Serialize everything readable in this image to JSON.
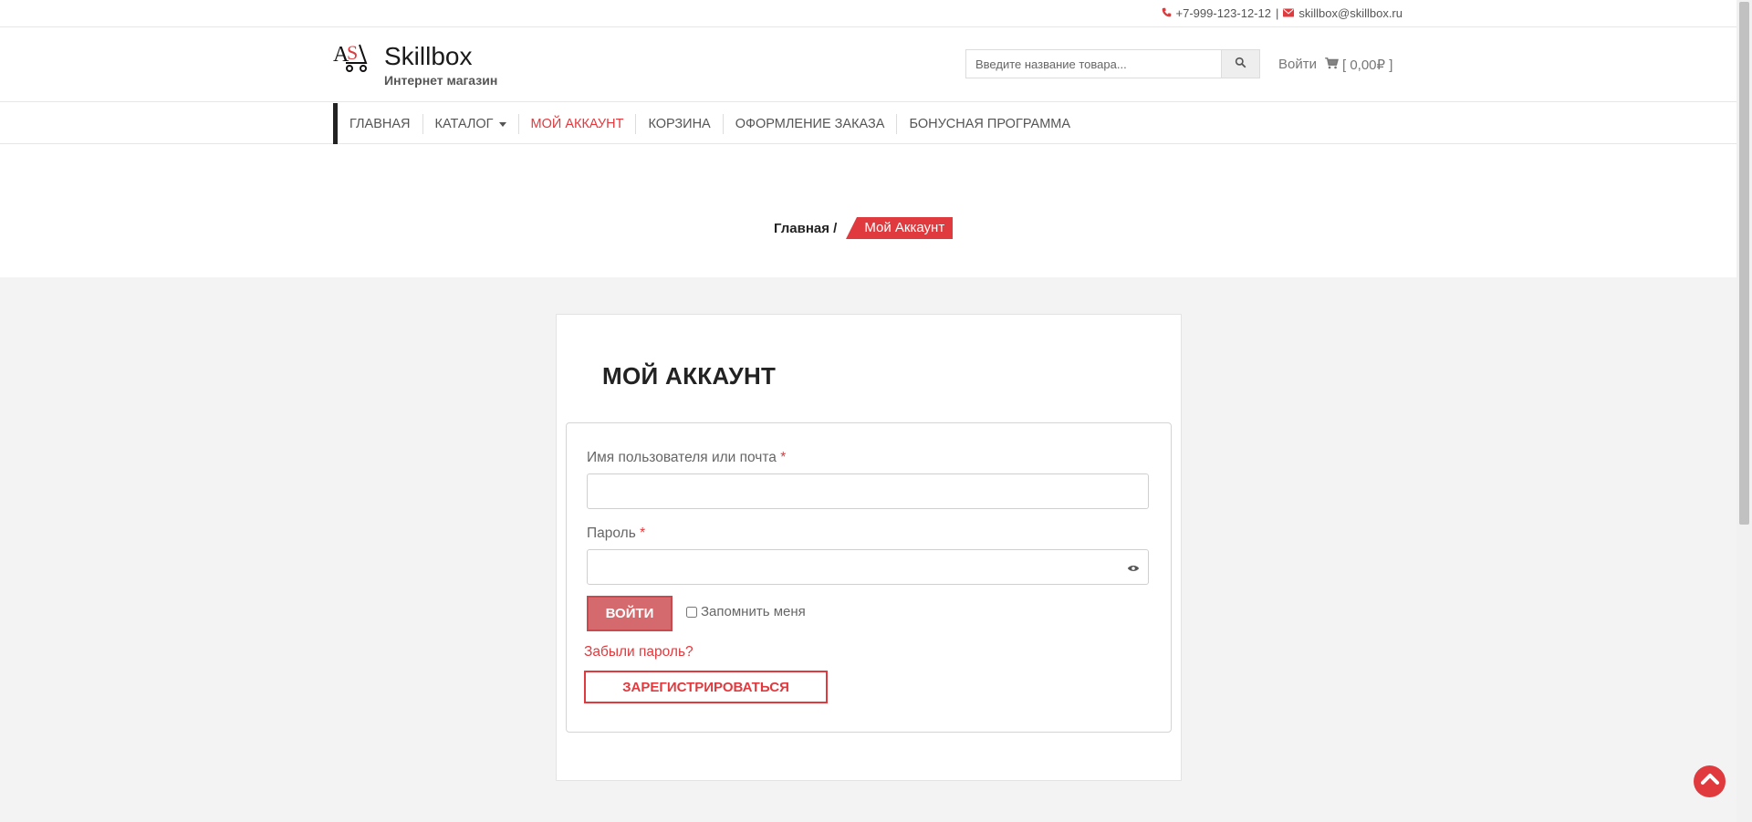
{
  "topbar": {
    "phone": "+7-999-123-12-12",
    "separator": "|",
    "email": "skillbox@skillbox.ru"
  },
  "header": {
    "brand_name": "Skillbox",
    "brand_tagline": "Интернет магазин",
    "search_placeholder": "Введите название товара...",
    "login_label": "Войти",
    "cart_label": "[ 0,00₽ ]"
  },
  "nav": {
    "items": [
      {
        "label": "ГЛАВНАЯ"
      },
      {
        "label": "КАТАЛОГ"
      },
      {
        "label": "МОЙ АККАУНТ"
      },
      {
        "label": "КОРЗИНА"
      },
      {
        "label": "ОФОРМЛЕНИЕ ЗАКАЗА"
      },
      {
        "label": "БОНУСНАЯ ПРОГРАММА"
      }
    ],
    "active": "МОЙ АККАУНТ"
  },
  "breadcrumb": {
    "home": "Главная /",
    "current": "Мой Аккаунт"
  },
  "account": {
    "title": "МОЙ АККАУНТ",
    "username_label": "Имя пользователя или почта",
    "password_label": "Пароль",
    "required_mark": "*",
    "login_button": "ВОЙТИ",
    "remember_label": "Запомнить меня",
    "forgot_link": "Забыли пароль?",
    "register_button": "ЗАРЕГИСТРИРОВАТЬСЯ"
  },
  "colors": {
    "accent": "#e03a3e",
    "login_button_bg": "#d46a6e",
    "page_bg": "#f3f3f3"
  }
}
